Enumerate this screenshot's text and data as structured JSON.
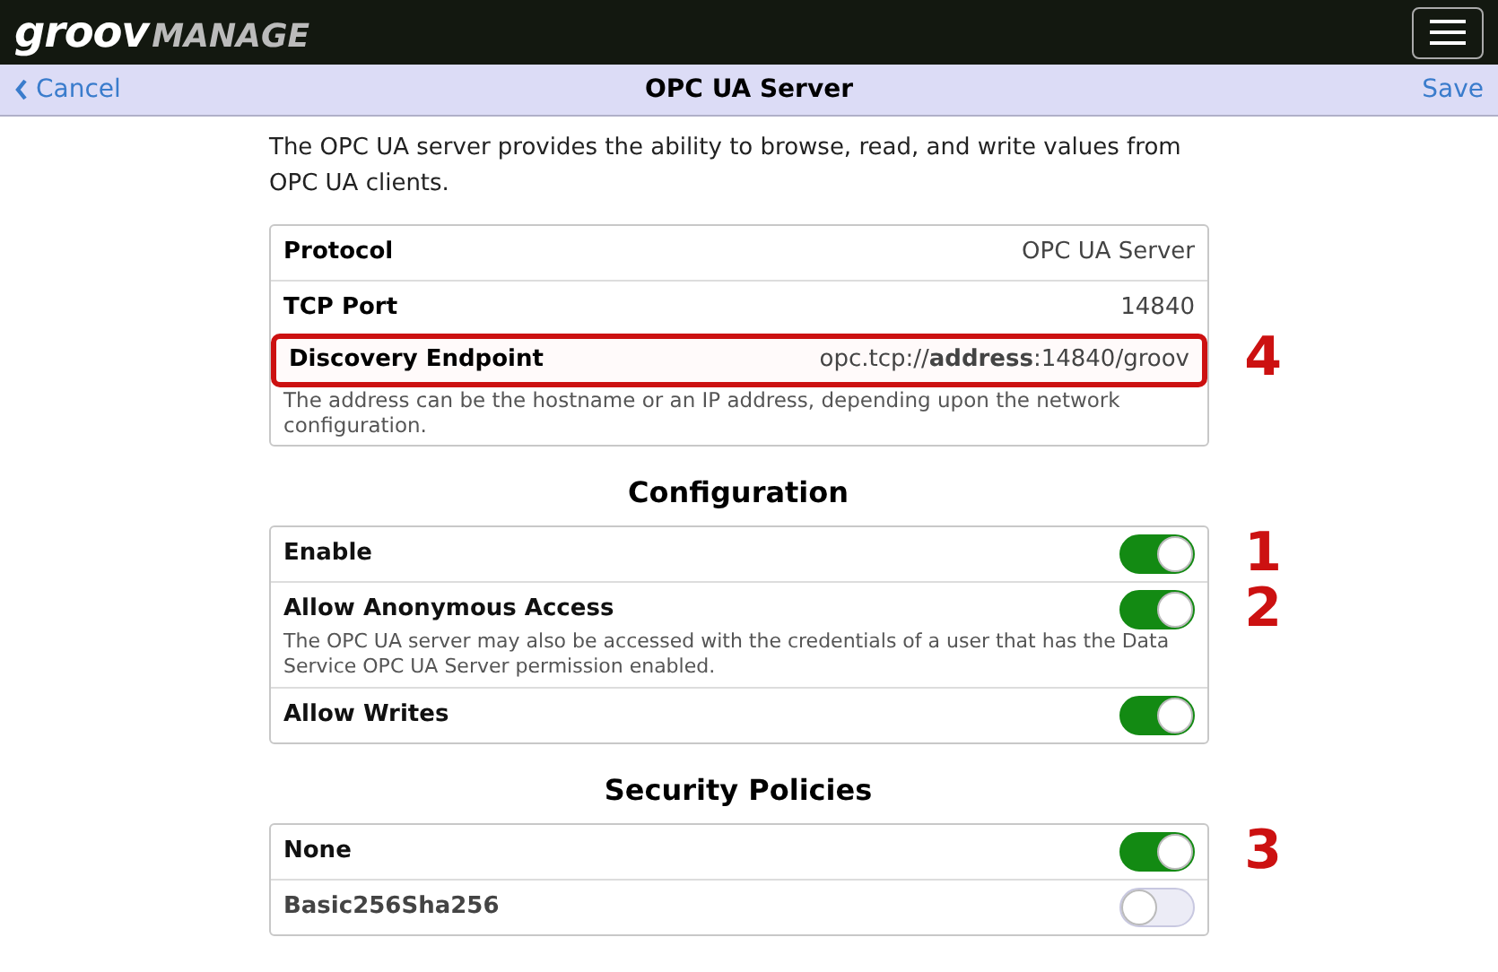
{
  "header": {
    "logo_bold": "groov",
    "logo_light": "MANAGE"
  },
  "nav": {
    "back": "Cancel",
    "title": "OPC UA Server",
    "action": "Save"
  },
  "intro": "The OPC UA server provides the ability to browse, read, and write values from OPC UA clients.",
  "info": {
    "rows": [
      {
        "label": "Protocol",
        "value": "OPC UA Server",
        "highlighted": false
      },
      {
        "label": "TCP Port",
        "value": "14840",
        "highlighted": false
      },
      {
        "label": "Discovery Endpoint",
        "value": "opc.tcp://**address**:14840/groov",
        "highlighted": true,
        "callout": "4"
      }
    ],
    "note": "The address can be the hostname or an IP address, depending upon the network configuration."
  },
  "sections": [
    {
      "title": "Configuration",
      "rows": [
        {
          "label": "Enable",
          "on": true,
          "callout": "1"
        },
        {
          "label": "Allow Anonymous Access",
          "on": true,
          "callout": "2",
          "description": "The OPC UA server may also be accessed with the credentials of a user that has the Data Service OPC UA Server permission enabled."
        },
        {
          "label": "Allow Writes",
          "on": true
        }
      ]
    },
    {
      "title": "Security Policies",
      "rows": [
        {
          "label": "None",
          "on": true,
          "callout": "3"
        },
        {
          "label": "Basic256Sha256",
          "on": false
        }
      ]
    }
  ]
}
